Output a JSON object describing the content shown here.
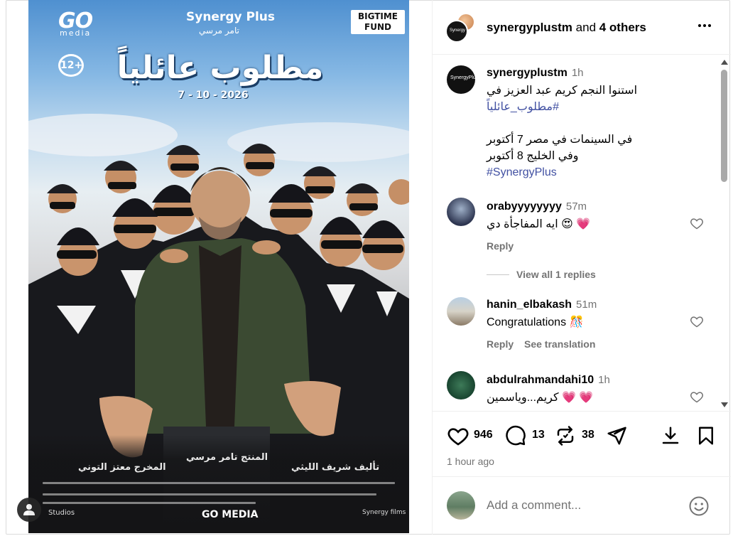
{
  "poster": {
    "brand_go": "GO",
    "brand_media": "media",
    "brand_synergy": "Synergy Plus",
    "brand_tamer": "تامر مرسي",
    "brand_bigtime": "BIGTIME FUND",
    "rating": "12+",
    "title": "مطلوب عائلياً",
    "date": "7 - 10 - 2026",
    "producer": "المنتج تامر مرسي",
    "director": "المخرج معتز التوني",
    "writer": "تأليف شريف الليثي",
    "go_media": "GO MEDIA",
    "studios": "Studios",
    "synergy_films": "Synergy films"
  },
  "header": {
    "username": "synergyplustm",
    "and_text": " and ",
    "others": "4 others",
    "more_icon": "more-horizontal-icon"
  },
  "caption": {
    "username": "synergyplustm",
    "time": "1h",
    "line1": "استنوا النجم كريم عبد العزيز في",
    "hashtag1": "#مطلوب_عائلياً",
    "line2": "في السينمات في مصر 7 أكتوبر",
    "line3": "وفي الخليج 8 أكتوبر",
    "hashtag2": "#SynergyPlus"
  },
  "comments": [
    {
      "username": "orabyyyyyyyy",
      "time": "57m",
      "text": "ايه المفاجأة دي 😍 💗",
      "reply": "Reply"
    },
    {
      "username": "hanin_elbakash",
      "time": "51m",
      "text": "Congratulations 🎊",
      "reply": "Reply",
      "see_translation": "See translation"
    },
    {
      "username": "abdulrahmandahi10",
      "time": "1h",
      "text": "كريم...وياسمين 💗 💗"
    }
  ],
  "view_replies": "View all 1 replies",
  "actions": {
    "likes": "946",
    "comments": "13",
    "reposts": "38",
    "time_ago": "1 hour ago"
  },
  "add_comment": {
    "placeholder": "Add a comment..."
  },
  "colors": {
    "link": "#4150a2",
    "secondary_text": "#737373",
    "border": "#efefef"
  }
}
